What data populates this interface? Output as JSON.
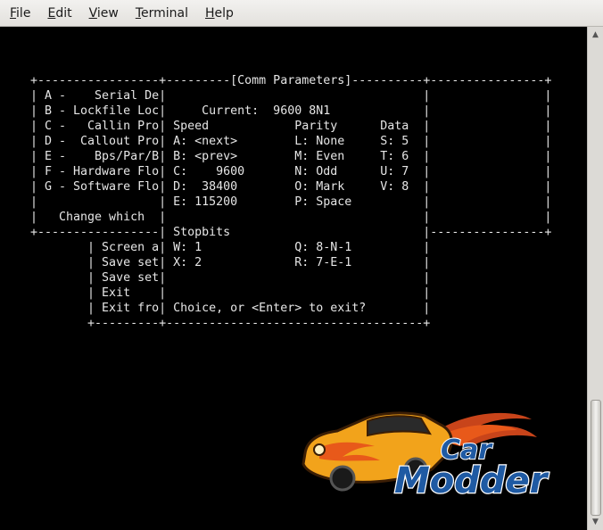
{
  "menubar": {
    "items": [
      "File",
      "Edit",
      "View",
      "Terminal",
      "Help"
    ]
  },
  "terminal": {
    "lines": [
      "+-----------------+---------[Comm Parameters]----------+----------------+",
      "| A -    Serial De|                                    |                |",
      "| B - Lockfile Loc|     Current:  9600 8N1             |                |",
      "| C -   Callin Pro| Speed            Parity      Data  |                |",
      "| D -  Callout Pro| A: <next>        L: None     S: 5  |                |",
      "| E -    Bps/Par/B| B: <prev>        M: Even     T: 6  |                |",
      "| F - Hardware Flo| C:    9600       N: Odd      U: 7  |                |",
      "| G - Software Flo| D:  38400        O: Mark     V: 8  |                |",
      "|                 | E: 115200        P: Space          |                |",
      "|   Change which  |                                    |                |",
      "+-----------------| Stopbits                           |----------------+",
      "        | Screen a| W: 1             Q: 8-N-1          |",
      "        | Save set| X: 2             R: 7-E-1          |",
      "        | Save set|                                    |",
      "        | Exit    |                                    |",
      "        | Exit fro| Choice, or <Enter> to exit?        |",
      "        +---------+------------------------------------+"
    ]
  },
  "logo": {
    "line1": "Car",
    "line2": "Modder",
    "colors": {
      "car_body": "#f2a31b",
      "flame": "#e8591a",
      "text_fill": "#1f5aa3",
      "text_outline": "#ffffff"
    }
  },
  "scrollbar": {
    "up_icon": "arrow-up-icon",
    "down_icon": "arrow-down-icon"
  }
}
